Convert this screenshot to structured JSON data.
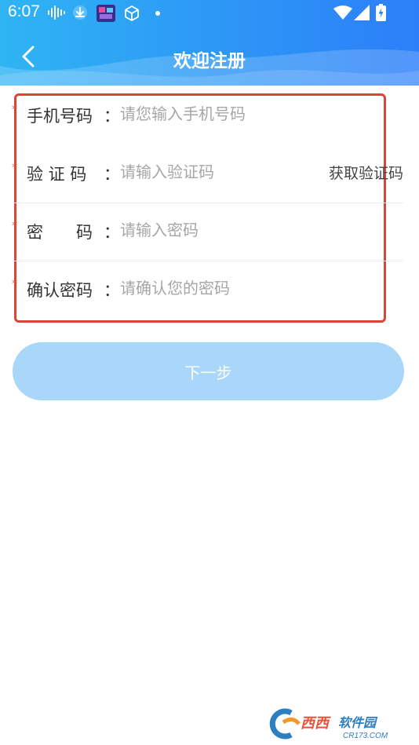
{
  "status_bar": {
    "time": "6:07",
    "icons": [
      "audio-wave-icon",
      "download-icon",
      "app-thumbnail-icon",
      "cube-icon",
      "dot-icon",
      "wifi-icon",
      "signal-icon",
      "battery-charging-icon"
    ]
  },
  "header": {
    "title": "欢迎注册",
    "back_icon": "chevron-left-icon"
  },
  "form": {
    "required_mark": "*",
    "colon": "：",
    "fields": [
      {
        "label": "手机号码",
        "placeholder": "请您输入手机号码",
        "value": ""
      },
      {
        "label": "验 证 码",
        "placeholder": "请输入验证码",
        "value": ""
      },
      {
        "label": "密　　码",
        "placeholder": "请输入密码",
        "value": ""
      },
      {
        "label": "确认密码",
        "placeholder": "请确认您的密码",
        "value": ""
      }
    ],
    "get_code_label": "获取验证码"
  },
  "next_button": {
    "label": "下一步"
  },
  "watermark": {
    "brand": "西西软件园",
    "url": "CR173.COM"
  },
  "colors": {
    "header_start": "#2fb4f3",
    "header_end": "#2c7ff8",
    "annotation_border": "#d8463a",
    "required_mark": "#e64a3a",
    "button_bg": "#a9d7fa"
  }
}
